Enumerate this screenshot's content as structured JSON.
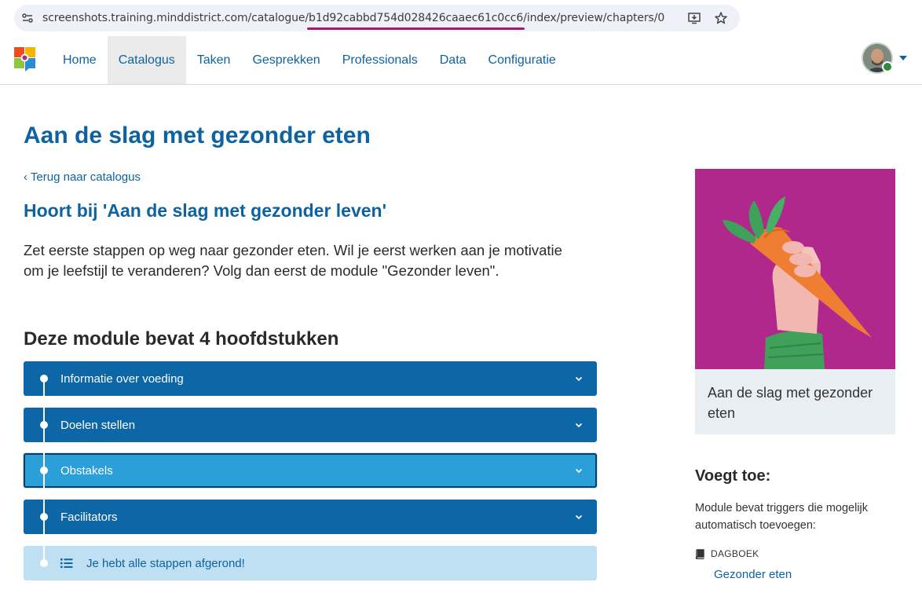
{
  "browser": {
    "url_prefix": "screenshots.training.minddistrict.com/catalogue/",
    "url_highlight": "b1d92cabbd754d028426caaec61c0cc6",
    "url_suffix": "/index/preview/chapters/0"
  },
  "nav": {
    "items": [
      {
        "label": "Home",
        "active": false
      },
      {
        "label": "Catalogus",
        "active": true
      },
      {
        "label": "Taken",
        "active": false
      },
      {
        "label": "Gesprekken",
        "active": false
      },
      {
        "label": "Professionals",
        "active": false
      },
      {
        "label": "Data",
        "active": false
      },
      {
        "label": "Configuratie",
        "active": false
      }
    ]
  },
  "main": {
    "title": "Aan de slag met gezonder eten",
    "back_link": "Terug naar catalogus",
    "belongs_to": "Hoort bij 'Aan de slag met gezonder leven'",
    "description": "Zet eerste stappen op weg naar gezonder eten. Wil je eerst werken aan je motivatie om je leefstijl te veranderen? Volg dan eerst de module \"Gezonder leven\".",
    "chapters_title": "Deze module bevat 4 hoofdstukken",
    "chapters": [
      {
        "label": "Informatie over voeding",
        "selected": false
      },
      {
        "label": "Doelen stellen",
        "selected": false
      },
      {
        "label": "Obstakels",
        "selected": true
      },
      {
        "label": "Facilitators",
        "selected": false
      }
    ],
    "completed_text": "Je hebt alle stappen afgerond!"
  },
  "sidebar": {
    "card_title": "Aan de slag met gezonder eten",
    "adds_title": "Voegt toe:",
    "adds_text": "Module bevat triggers die mogelijk automatisch toevoegen:",
    "diary_label": "DAGBOEK",
    "diary_link": "Gezonder eten"
  },
  "colors": {
    "brand_blue": "#0e62a0",
    "chapter_bg": "#0d67a6",
    "chapter_selected": "#2b9fd8",
    "card_image_bg": "#b0288c"
  }
}
